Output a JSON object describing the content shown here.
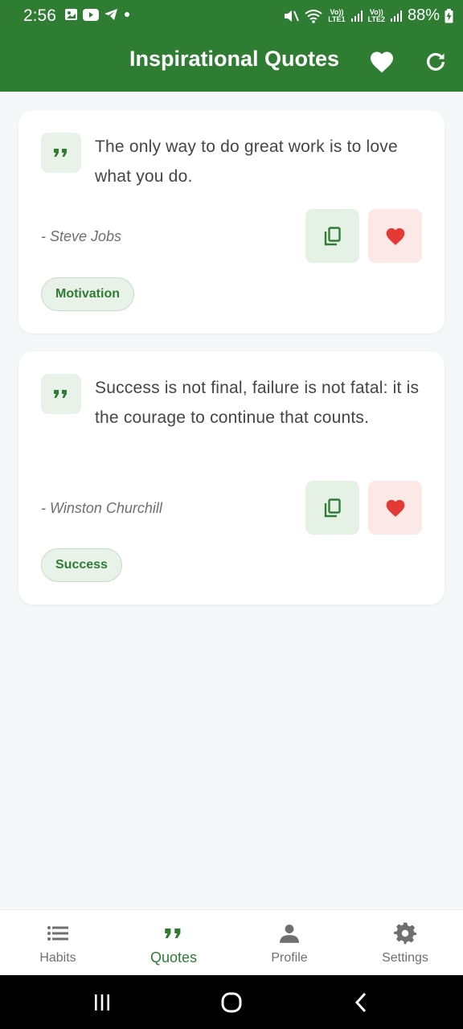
{
  "status_bar": {
    "time": "2:56",
    "sim1_top": "Vo))",
    "sim1_bottom": "LTE1",
    "sim2_top": "Vo))",
    "sim2_bottom": "LTE2",
    "battery": "88%"
  },
  "app_bar": {
    "title": "Inspirational Quotes",
    "favorites_icon": "heart-icon",
    "refresh_icon": "refresh-icon"
  },
  "quotes": [
    {
      "text": "The only way to do great work is to love what you do.",
      "author": "- Steve Jobs",
      "tag": "Motivation"
    },
    {
      "text": "Success is not final, failure is not fatal: it is the courage to continue that counts.",
      "author": "- Winston Churchill",
      "tag": "Success"
    }
  ],
  "bottom_nav": {
    "items": [
      {
        "label": "Habits",
        "icon": "list-icon"
      },
      {
        "label": "Quotes",
        "icon": "quote-icon"
      },
      {
        "label": "Profile",
        "icon": "person-icon"
      },
      {
        "label": "Settings",
        "icon": "gear-icon"
      }
    ],
    "active": "Quotes"
  },
  "colors": {
    "primary": "#2e7d32",
    "heart": "#e53935",
    "background": "#f6f7f9"
  }
}
